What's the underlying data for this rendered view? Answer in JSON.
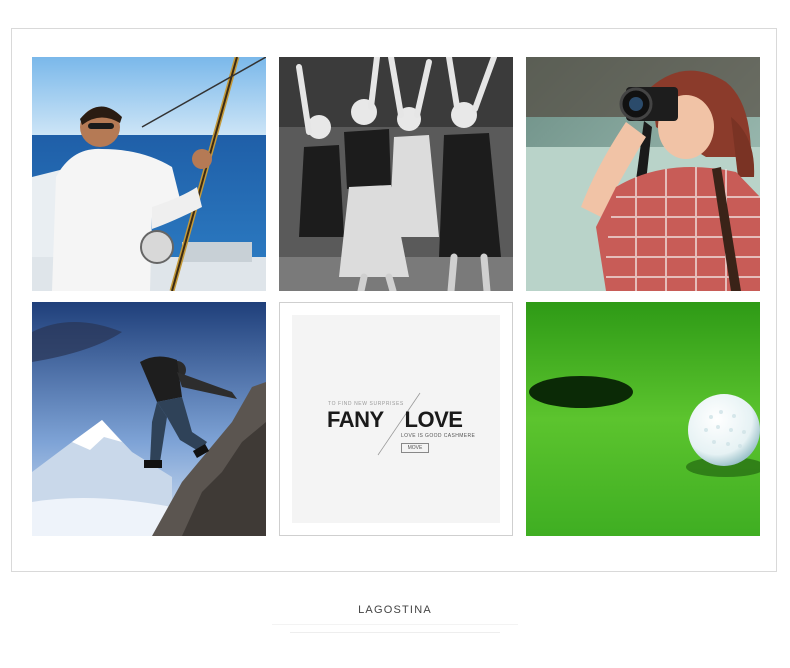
{
  "brand_tile": {
    "tagline": "TO FIND NEW SURPRISES",
    "name_left": "FANY",
    "name_right": "LOVE",
    "subline": "LOVE IS GOOD CASHMERE",
    "button": "MOVE"
  },
  "footer": {
    "brand": "LAGOSTINA"
  },
  "colors": {
    "frame_border": "#d9d9d9",
    "sea": "#2f6fb2",
    "sky": "#8fc3ea",
    "grass": "#3fae22"
  }
}
